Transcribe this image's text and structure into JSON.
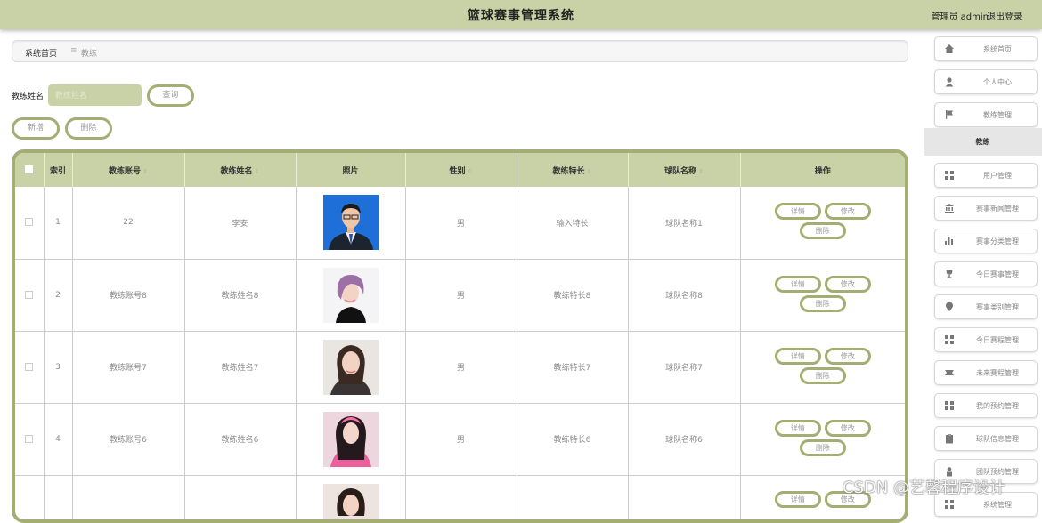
{
  "app": {
    "title": "篮球赛事管理系统",
    "user_label": "管理员 admin",
    "logout_label": "退出登录"
  },
  "breadcrumb": {
    "home": "系统首页",
    "separator": "≡",
    "current": "教练"
  },
  "search": {
    "label": "教练姓名",
    "placeholder": "教练姓名",
    "value": "",
    "query_button": "查询"
  },
  "toolbar": {
    "add_button": "新增",
    "delete_button": "删除"
  },
  "table": {
    "headers": {
      "index": "索引",
      "account": "教练账号",
      "name": "教练姓名",
      "photo": "照片",
      "gender": "性别",
      "specialty": "教练特长",
      "team": "球队名称",
      "actions": "操作"
    },
    "sort_glyph": "⇕",
    "action_labels": {
      "detail": "详情",
      "edit": "修改",
      "delete": "删除"
    },
    "rows": [
      {
        "index": "1",
        "account": "22",
        "name": "李安",
        "gender": "男",
        "specialty": "输入特长",
        "team": "球队名称1"
      },
      {
        "index": "2",
        "account": "教练账号8",
        "name": "教练姓名8",
        "gender": "男",
        "specialty": "教练特长8",
        "team": "球队名称8"
      },
      {
        "index": "3",
        "account": "教练账号7",
        "name": "教练姓名7",
        "gender": "男",
        "specialty": "教练特长7",
        "team": "球队名称7"
      },
      {
        "index": "4",
        "account": "教练账号6",
        "name": "教练姓名6",
        "gender": "男",
        "specialty": "教练特长6",
        "team": "球队名称6"
      },
      {
        "index": "",
        "account": "",
        "name": "",
        "gender": "",
        "specialty": "",
        "team": ""
      }
    ]
  },
  "sidebar": {
    "items": [
      {
        "label": "系统首页",
        "icon": "home-icon"
      },
      {
        "label": "个人中心",
        "icon": "user-icon"
      },
      {
        "label": "教练管理",
        "icon": "flag-icon"
      },
      {
        "label": "教练",
        "icon": "",
        "active": true
      },
      {
        "label": "用户管理",
        "icon": "grid-icon"
      },
      {
        "label": "赛事新闻管理",
        "icon": "bank-icon"
      },
      {
        "label": "赛事分类管理",
        "icon": "bar-chart-icon"
      },
      {
        "label": "今日赛事管理",
        "icon": "trophy-icon"
      },
      {
        "label": "赛事类别管理",
        "icon": "pin-icon"
      },
      {
        "label": "今日赛程管理",
        "icon": "grid-icon"
      },
      {
        "label": "未来赛程管理",
        "icon": "tag-icon"
      },
      {
        "label": "我的预约管理",
        "icon": "grid-icon"
      },
      {
        "label": "球队信息管理",
        "icon": "clipboard-icon"
      },
      {
        "label": "团队预约管理",
        "icon": "person-icon"
      },
      {
        "label": "系统管理",
        "icon": "grid-icon"
      }
    ]
  },
  "watermark": "CSDN @艺馨程序设计",
  "colors": {
    "header_bg": "#c9d2a6",
    "accent_border": "#a4ad73"
  }
}
